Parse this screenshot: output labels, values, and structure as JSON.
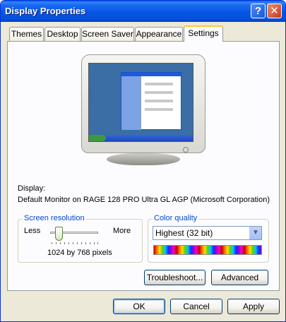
{
  "window": {
    "title": "Display Properties",
    "help_label": "?",
    "close_label": "✕"
  },
  "tabs": [
    {
      "label": "Themes"
    },
    {
      "label": "Desktop"
    },
    {
      "label": "Screen Saver"
    },
    {
      "label": "Appearance"
    },
    {
      "label": "Settings",
      "active": true
    }
  ],
  "display": {
    "label": "Display:",
    "device": "Default Monitor on RAGE 128 PRO Ultra GL AGP (Microsoft Corporation)"
  },
  "resolution": {
    "group_title": "Screen resolution",
    "less_label": "Less",
    "more_label": "More",
    "value_text": "1024 by 768 pixels",
    "slider_level": 0.12
  },
  "color_quality": {
    "group_title": "Color quality",
    "selected": "Highest (32 bit)",
    "arrow": "▼"
  },
  "buttons": {
    "troubleshoot": "Troubleshoot...",
    "advanced": "Advanced",
    "ok": "OK",
    "cancel": "Cancel",
    "apply": "Apply"
  },
  "colors": {
    "titlebar": "#0655E5",
    "window_bg": "#ECE9D8",
    "group_title": "#0046D5"
  }
}
